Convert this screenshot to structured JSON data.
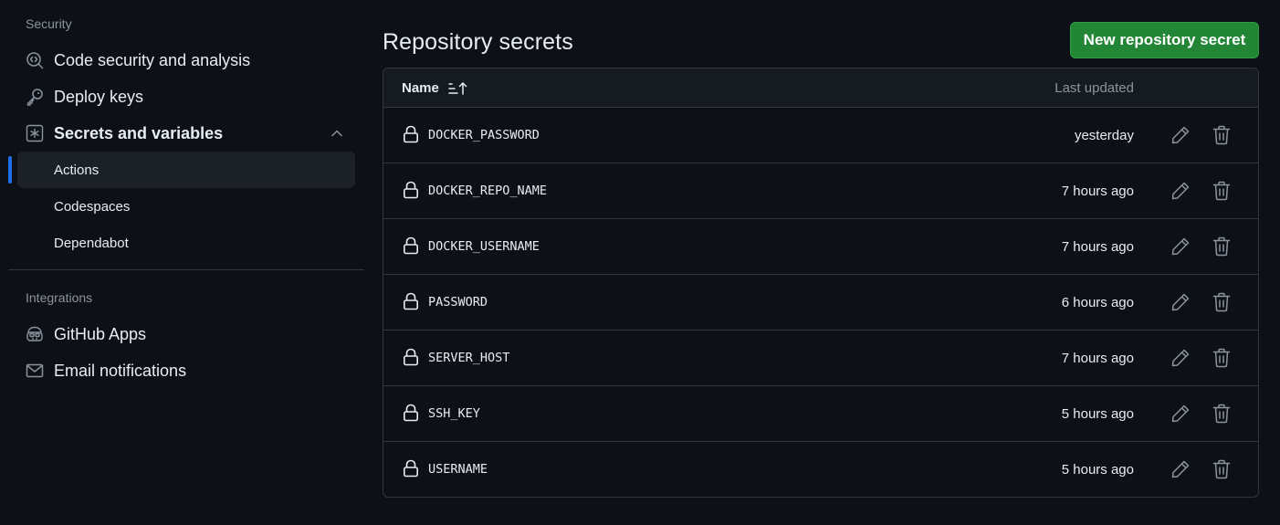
{
  "sidebar": {
    "security_heading": "Security",
    "items": [
      {
        "label": "Code security and analysis",
        "icon": "codescan-icon"
      },
      {
        "label": "Deploy keys",
        "icon": "key-icon"
      },
      {
        "label": "Secrets and variables",
        "icon": "asterisk-box-icon",
        "expanded": true
      }
    ],
    "sub_items": [
      {
        "label": "Actions",
        "active": true
      },
      {
        "label": "Codespaces",
        "active": false
      },
      {
        "label": "Dependabot",
        "active": false
      }
    ],
    "integrations_heading": "Integrations",
    "integration_items": [
      {
        "label": "GitHub Apps",
        "icon": "copilot-app-icon"
      },
      {
        "label": "Email notifications",
        "icon": "mail-icon"
      }
    ]
  },
  "main": {
    "title": "Repository secrets",
    "new_button_label": "New repository secret",
    "table": {
      "name_header": "Name",
      "updated_header": "Last updated",
      "rows": [
        {
          "name": "DOCKER_PASSWORD",
          "updated": "yesterday"
        },
        {
          "name": "DOCKER_REPO_NAME",
          "updated": "7 hours ago"
        },
        {
          "name": "DOCKER_USERNAME",
          "updated": "7 hours ago"
        },
        {
          "name": "PASSWORD",
          "updated": "6 hours ago"
        },
        {
          "name": "SERVER_HOST",
          "updated": "7 hours ago"
        },
        {
          "name": "SSH_KEY",
          "updated": "5 hours ago"
        },
        {
          "name": "USERNAME",
          "updated": "5 hours ago"
        }
      ]
    }
  },
  "colors": {
    "background": "#0d1117",
    "primary_button": "#238636",
    "active_indicator": "#1f6feb",
    "muted_text": "#8b949e",
    "border": "#30363d"
  }
}
